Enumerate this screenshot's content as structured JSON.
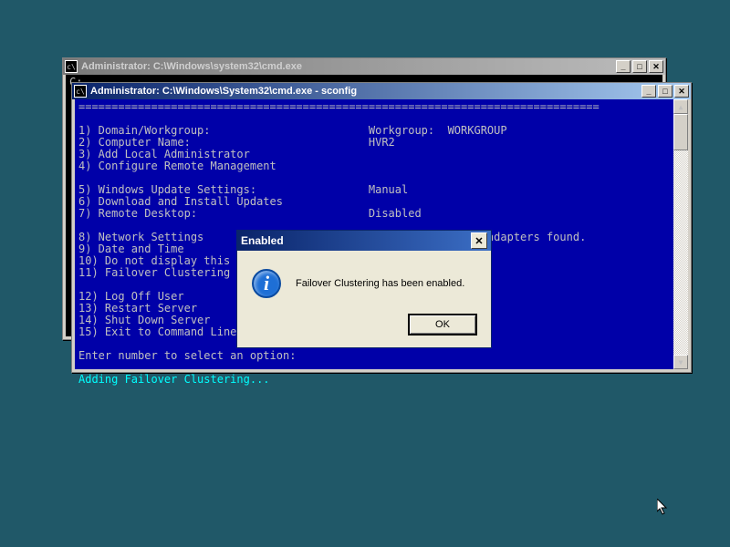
{
  "desktop": {
    "bg": "#205868"
  },
  "back_window": {
    "title": "Administrator: C:\\Windows\\system32\\cmd.exe",
    "prompt": "C:"
  },
  "front_window": {
    "title": "Administrator: C:\\Windows\\System32\\cmd.exe - sconfig",
    "divider": "===============================================================================",
    "menu": {
      "1": {
        "label": "Domain/Workgroup:",
        "value": "Workgroup:  WORKGROUP"
      },
      "2": {
        "label": "Computer Name:",
        "value": "HVR2"
      },
      "3": {
        "label": "Add Local Administrator",
        "value": ""
      },
      "4": {
        "label": "Configure Remote Management",
        "value": ""
      },
      "5": {
        "label": "Windows Update Settings:",
        "value": "Manual"
      },
      "6": {
        "label": "Download and Install Updates",
        "value": ""
      },
      "7": {
        "label": "Remote Desktop:",
        "value": "Disabled"
      },
      "8": {
        "label": "Network Settings",
        "value": "No active network adapters found."
      },
      "9": {
        "label": "Date and Time",
        "value": ""
      },
      "10": {
        "label": "Do not display this menu at login",
        "value": ""
      },
      "11": {
        "label": "Failover Clustering Feature",
        "value": ""
      },
      "12": {
        "label": "Log Off User",
        "value": ""
      },
      "13": {
        "label": "Restart Server",
        "value": ""
      },
      "14": {
        "label": "Shut Down Server",
        "value": ""
      },
      "15": {
        "label": "Exit to Command Line",
        "value": ""
      }
    },
    "prompt": "Enter number to select an option:",
    "status": "Adding Failover Clustering..."
  },
  "dialog": {
    "title": "Enabled",
    "message": "Failover Clustering has been enabled.",
    "ok": "OK",
    "icon": "info-icon"
  },
  "title_buttons": {
    "min": "_",
    "max": "□",
    "close": "✕"
  },
  "scrollbar": {
    "up": "▲",
    "down": "▼"
  }
}
